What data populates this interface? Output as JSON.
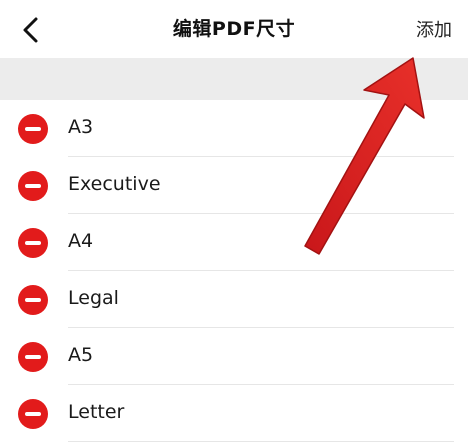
{
  "nav": {
    "back_icon": "chevron-left-icon",
    "title": "编辑PDF尺寸",
    "add_label": "添加"
  },
  "sizes": {
    "items": [
      {
        "label": "A3"
      },
      {
        "label": "Executive"
      },
      {
        "label": "A4"
      },
      {
        "label": "Legal"
      },
      {
        "label": "A5"
      },
      {
        "label": "Letter"
      }
    ],
    "delete_icon": "minus-circle-icon"
  },
  "colors": {
    "delete_red": "#e21b1b",
    "arrow_red": "#d6201c",
    "section_gray": "#ececec"
  }
}
